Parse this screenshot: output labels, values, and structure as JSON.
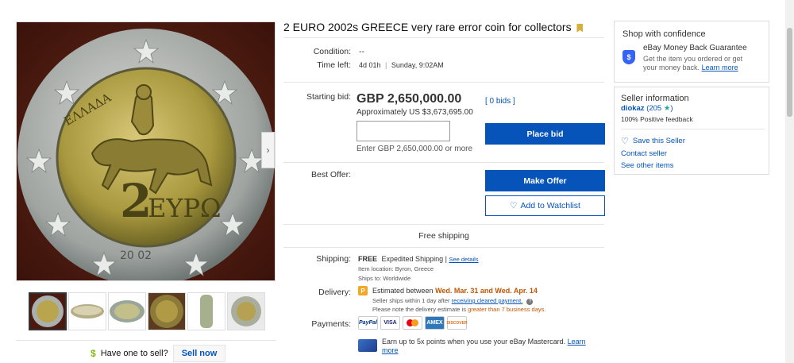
{
  "title": "2 EURO 2002s GREECE very rare error coin for collectors",
  "coin": {
    "text_2": "2",
    "text_eypo": "ΕΥΡΩ",
    "text_ellada": "ΕΛΛΑΔΑ",
    "text_year": "20  02"
  },
  "details": {
    "condition_label": "Condition:",
    "condition_value": "--",
    "time_left_label": "Time left:",
    "time_left_value": "4d 01h",
    "time_left_end": "Sunday, 9:02AM"
  },
  "bid": {
    "starting_label": "Starting bid:",
    "price": "GBP 2,650,000.00",
    "approx": "Approximately US $3,673,695.00",
    "bids": "[ 0 bids ]",
    "input_value": "",
    "enter": "Enter GBP 2,650,000.00 or more",
    "place_bid": "Place bid"
  },
  "offer": {
    "label": "Best Offer:",
    "make_offer": "Make Offer",
    "watchlist": "Add to Watchlist"
  },
  "free_shipping": "Free shipping",
  "shipping": {
    "label": "Shipping:",
    "free": "FREE",
    "method": "Expedited Shipping |",
    "see_details": "See details",
    "location": "Item location: Byron, Greece",
    "ships_to": "Ships to: Worldwide"
  },
  "delivery": {
    "label": "Delivery:",
    "estimated": "Estimated between",
    "dates": "Wed. Mar. 31 and Wed. Apr. 14",
    "note1_prefix": "Seller ships within 1 day after",
    "note1_link": "receiving cleared payment.",
    "note2_prefix": "Please note the delivery estimate is",
    "note2_emph": "greater than 7 business days."
  },
  "payments": {
    "label": "Payments:",
    "paypal": "PayPal",
    "visa": "VISA",
    "amex": "AMEX",
    "discover": "DISCOVER"
  },
  "mastercard_promo": {
    "text": "Earn up to 5x points when you use your eBay Mastercard.",
    "link1": "Learn",
    "link2": "more"
  },
  "sell": {
    "question": "Have one to sell?",
    "button": "Sell now"
  },
  "confidence": {
    "title": "Shop with confidence",
    "guarantee": "eBay Money Back Guarantee",
    "desc1": "Get the item you ordered or get",
    "desc2": "your money back.",
    "learn_more": "Learn more"
  },
  "seller": {
    "title": "Seller information",
    "name": "diokaz",
    "feedback_count": "(205",
    "feedback_close": ")",
    "positive": "100% Positive feedback",
    "save": "Save this Seller",
    "contact": "Contact seller",
    "other": "See other items"
  },
  "colors": {
    "accent": "#0654ba",
    "orange": "#c45500",
    "star": "#21a89a"
  }
}
